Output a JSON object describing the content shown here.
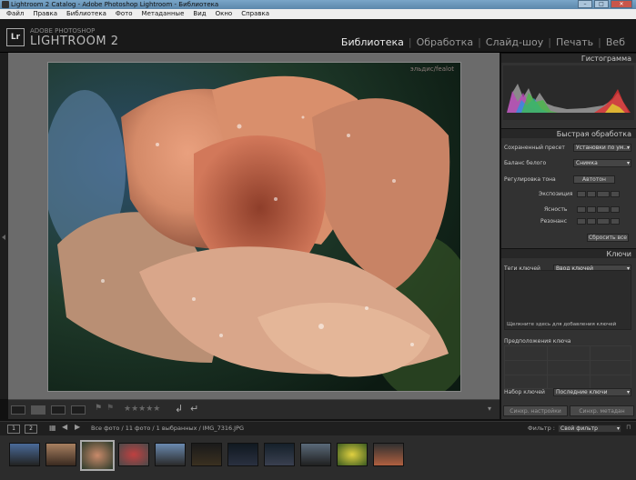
{
  "window": {
    "title": "Lightroom 2 Catalog - Adobe Photoshop Lightroom - Библиотека"
  },
  "menu": [
    "Файл",
    "Правка",
    "Библиотека",
    "Фото",
    "Метаданные",
    "Вид",
    "Окно",
    "Справка"
  ],
  "brand": {
    "logo": "Lr",
    "line1": "ADOBE PHOTOSHOP",
    "line2": "LIGHTROOM 2"
  },
  "modules": [
    "Библиотека",
    "Обработка",
    "Слайд-шоу",
    "Печать",
    "Веб"
  ],
  "photo": {
    "watermark": "эльдис/fealot"
  },
  "panel": {
    "histogram": "Гистограмма",
    "quick": "Быстрая обработка",
    "saved_preset_label": "Сохраненный пресет",
    "saved_preset_value": "Установки по ум...",
    "wb_label": "Баланс белого",
    "wb_value": "Снимка",
    "tone_label": "Регулировка тона",
    "auto_tone": "Автотон",
    "exposure": "Экспозиция",
    "clarity": "Ясность",
    "vibrance": "Резонанс",
    "reset": "Сбросить все",
    "keywords": "Ключи",
    "kw_tags_label": "Теги ключей",
    "kw_tags_value": "Ввод ключей",
    "kw_hint": "Щелкните здесь для добавления ключей",
    "suggestions": "Предположения ключа",
    "kwset_label": "Набор ключей",
    "kwset_value": "Последние ключи",
    "sync_settings": "Синхр. настройки",
    "sync_meta": "Синхр. метадан"
  },
  "filmbar": {
    "btn1": "1",
    "btn2": "2",
    "path": "Все фото / 11 фото / 1 выбранных / IMG_7316.JPG",
    "filter_label": "Фильтр :",
    "filter_value": "Свой фильтр"
  },
  "toolbar": {
    "stars": "★★★★★"
  },
  "colors": {
    "accent": "#f0f0f0",
    "panel": "#323232",
    "canvas": "#6b6b6b"
  }
}
